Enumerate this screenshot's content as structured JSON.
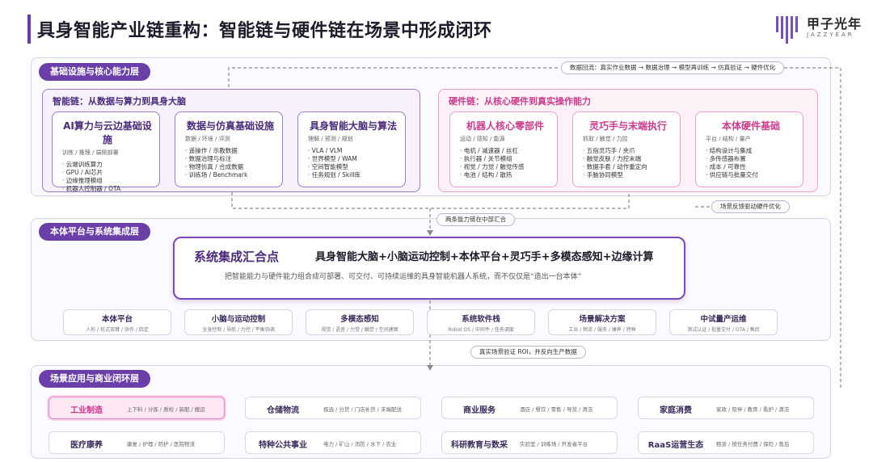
{
  "title": "具身智能产业链重构：智能链与硬件链在场景中形成闭环",
  "logo": {
    "cn": "甲子光年",
    "en": "JAZZYEAR"
  },
  "colors": {
    "primary": "#6b3fa8",
    "pink": "#ef9fd0",
    "highlight": "#d0358e"
  },
  "top_layer": {
    "tag": "基础设施与核心能力层",
    "loop_note": "数据回流：真实作业数据 → 数据治理 → 模型再训练 → 仿真验证 → 硬件优化",
    "intelligence": {
      "title": "智能链：从数据与算力到具身大脑",
      "cards": [
        {
          "title": "AI算力与云边基础设施",
          "sub": "训练 / 推理 / 端侧部署",
          "items": [
            "云端训练算力",
            "GPU / AI芯片",
            "边缘推理模组",
            "机器人控制器 / OTA"
          ]
        },
        {
          "title": "数据与仿真基础设施",
          "sub": "数据 / 环境 / 评测",
          "items": [
            "遥操作 / 示教数据",
            "数据治理与标注",
            "物理仿真 / 合成数据",
            "训练场 / Benchmark"
          ]
        },
        {
          "title": "具身智能大脑与算法",
          "sub": "理解 / 预测 / 规划",
          "items": [
            "VLA / VLM",
            "世界模型 / WAM",
            "空间智能模型",
            "任务规划 / Skill库"
          ]
        }
      ]
    },
    "hardware": {
      "title": "硬件链：从核心硬件到真实操作能力",
      "cards": [
        {
          "title": "机器人核心零部件",
          "sub": "运动 / 感知 / 能源",
          "items": [
            "电机 / 减速器 / 丝杠",
            "执行器 / 关节模组",
            "视觉 / 力觉 / 触觉传感",
            "电池 / 结构 / 散热"
          ]
        },
        {
          "title": "灵巧手与末端执行",
          "sub": "抓取 / 触觉 / 力控",
          "items": [
            "五指灵巧手 / 夹爪",
            "触觉皮肤 / 力控末端",
            "数据手套 / 动作重定向",
            "手脑协同模型"
          ]
        },
        {
          "title": "本体硬件基础",
          "sub": "平台 / 结构 / 量产",
          "items": [
            "结构设计与集成",
            "多传感器布置",
            "成本 / 可靠性",
            "供应链与批量交付"
          ]
        }
      ]
    },
    "converge_note": "两条能力链在中部汇合",
    "feedback_note": "场景反馈驱动硬件优化"
  },
  "middle_layer": {
    "tag": "本体平台与系统集成层",
    "hub": {
      "label": "系统集成汇合点",
      "formula": "具身智能大脑+小脑运动控制+本体平台+灵巧手+多模态感知+边缘计算",
      "desc": "把智能能力与硬件能力组合成可部署、可交付、可持续运维的具身智能机器人系统，而不仅仅是“造出一台本体”"
    },
    "modules": [
      {
        "title": "本体平台",
        "sub": "人形 / 轮式双臂 / 协作 / 四足"
      },
      {
        "title": "小脑与运动控制",
        "sub": "全身控制 / 导航 / 力控 / 平衡协调"
      },
      {
        "title": "多模态感知",
        "sub": "视觉 / 语音 / 力觉 / 触觉 / 空间建图"
      },
      {
        "title": "系统软件栈",
        "sub": "Robot OS / 中间件 / 任务调度"
      },
      {
        "title": "场景解决方案",
        "sub": "工业 / 物流 / 服务 / 康养 / 特种"
      },
      {
        "title": "中试量产运维",
        "sub": "测试认证 / 批量交付 / OTA / 售后"
      }
    ],
    "down_note": "真实场景验证 ROI，并反向生产数据"
  },
  "bottom_layer": {
    "tag": "场景应用与商业闭环层",
    "scenes": [
      {
        "title": "工业制造",
        "sub": "上下料 / 分拣 / 质检 / 装配 / 搬运"
      },
      {
        "title": "仓储物流",
        "sub": "拣选 / 分货 / 门店补货 / 末端配送"
      },
      {
        "title": "商业服务",
        "sub": "酒店 / 餐饮 / 零售 / 导览 / 清洁"
      },
      {
        "title": "家庭消费",
        "sub": "家政 / 陪伴 / 教育 / 看护 / 清洁"
      },
      {
        "title": "医疗康养",
        "sub": "康复 / 护理 / 陪护 / 医院物流"
      },
      {
        "title": "特种公共事业",
        "sub": "电力 / 矿山 / 消防 / 水下 / 农业"
      },
      {
        "title": "科研教育与数采",
        "sub": "实验室 / 训练场 / 开发者平台"
      },
      {
        "title": "RaaS运营生态",
        "sub": "租赁 / 按任务付费 / 保险 / 售后"
      }
    ]
  }
}
